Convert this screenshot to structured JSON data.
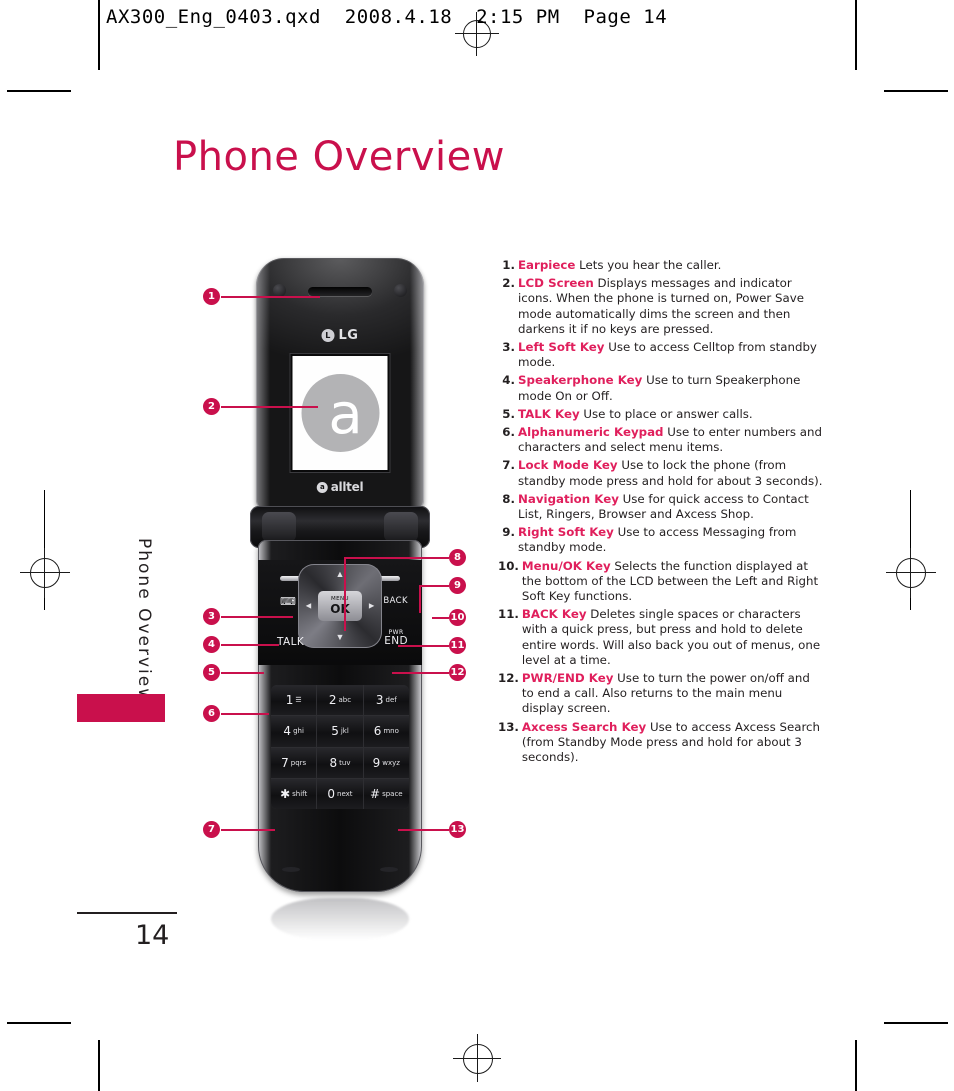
{
  "printer_slug": "AX300_Eng_0403.qxd  2008.4.18  2:15 PM  Page 14",
  "page": {
    "title": "Phone Overview",
    "side_label": "Phone Overview",
    "number": "14",
    "accent_color": "#c9104c",
    "term_color": "#e01f5c",
    "text_color": "#231f20"
  },
  "phone": {
    "brand": "LG",
    "brand_mark": "L",
    "carrier": "alltel",
    "carrier_mark": "a",
    "screen_glyph": "a",
    "ok_top_label": "MENU",
    "ok_label": "OK",
    "nav_up": "▲",
    "nav_down": "▼",
    "nav_left": "◄",
    "nav_right": "►",
    "speaker_key": "⌨",
    "back_key": "BACK",
    "talk_key": "TALK",
    "pwr_small": "PWR",
    "pwr_key": "END",
    "keypad": [
      {
        "num": "1",
        "sub": "☰",
        "subsmall": ""
      },
      {
        "num": "2",
        "sub": "abc",
        "subsmall": ""
      },
      {
        "num": "3",
        "sub": "def",
        "subsmall": ""
      },
      {
        "num": "4",
        "sub": "ghi",
        "subsmall": ""
      },
      {
        "num": "5",
        "sub": "jkl",
        "subsmall": ""
      },
      {
        "num": "6",
        "sub": "mno",
        "subsmall": ""
      },
      {
        "num": "7",
        "sub": "pqrs",
        "subsmall": ""
      },
      {
        "num": "8",
        "sub": "tuv",
        "subsmall": ""
      },
      {
        "num": "9",
        "sub": "wxyz",
        "subsmall": ""
      },
      {
        "num": "✱",
        "sub": "shift",
        "subsmall": "⚿"
      },
      {
        "num": "0",
        "sub": "next",
        "subsmall": ""
      },
      {
        "num": "#",
        "sub": "space",
        "subsmall": "⚲"
      }
    ]
  },
  "callouts": [
    {
      "n": "1"
    },
    {
      "n": "2"
    },
    {
      "n": "3"
    },
    {
      "n": "4"
    },
    {
      "n": "5"
    },
    {
      "n": "6"
    },
    {
      "n": "7"
    },
    {
      "n": "8"
    },
    {
      "n": "9"
    },
    {
      "n": "10"
    },
    {
      "n": "11"
    },
    {
      "n": "12"
    },
    {
      "n": "13"
    }
  ],
  "features": [
    {
      "idx": "1.",
      "term": "Earpiece",
      "desc": " Lets you hear the caller."
    },
    {
      "idx": "2.",
      "term": "LCD Screen",
      "desc": " Displays messages and indicator icons. When the phone is turned on, Power Save mode automatically dims the screen and then darkens it if no keys are pressed."
    },
    {
      "idx": "3.",
      "term": "Left Soft Key",
      "desc": " Use to access Celltop from standby mode."
    },
    {
      "idx": "4.",
      "term": "Speakerphone Key",
      "desc": " Use to turn Speakerphone mode On or Off."
    },
    {
      "idx": "5.",
      "term": "TALK Key",
      "desc": " Use to place or answer calls."
    },
    {
      "idx": "6.",
      "term": "Alphanumeric Keypad",
      "desc": " Use to enter numbers and characters and select menu items."
    },
    {
      "idx": "7.",
      "term": "Lock Mode Key",
      "desc": " Use to lock the phone (from standby mode press and hold for about 3 seconds)."
    },
    {
      "idx": "8.",
      "term": "Navigation Key",
      "desc": " Use for quick access to Contact List, Ringers, Browser and Axcess Shop."
    },
    {
      "idx": "9.",
      "term": "Right Soft Key",
      "desc": " Use to access Messaging from standby mode."
    },
    {
      "idx": "10.",
      "term": "Menu/OK Key",
      "desc": " Selects the function displayed at the bottom of the LCD between the Left and Right Soft Key functions."
    },
    {
      "idx": "11.",
      "term": "BACK Key",
      "desc": " Deletes single spaces or characters with a quick press, but press and hold to delete entire words. Will also back you out of menus, one level at a time."
    },
    {
      "idx": "12.",
      "term": "PWR/END Key",
      "desc": " Use to turn the power on/off and to end a call. Also returns to the main menu display screen."
    },
    {
      "idx": "13.",
      "term": "Axcess Search Key",
      "desc": " Use to access Axcess Search (from Standby Mode press and hold for about 3 seconds)."
    }
  ]
}
